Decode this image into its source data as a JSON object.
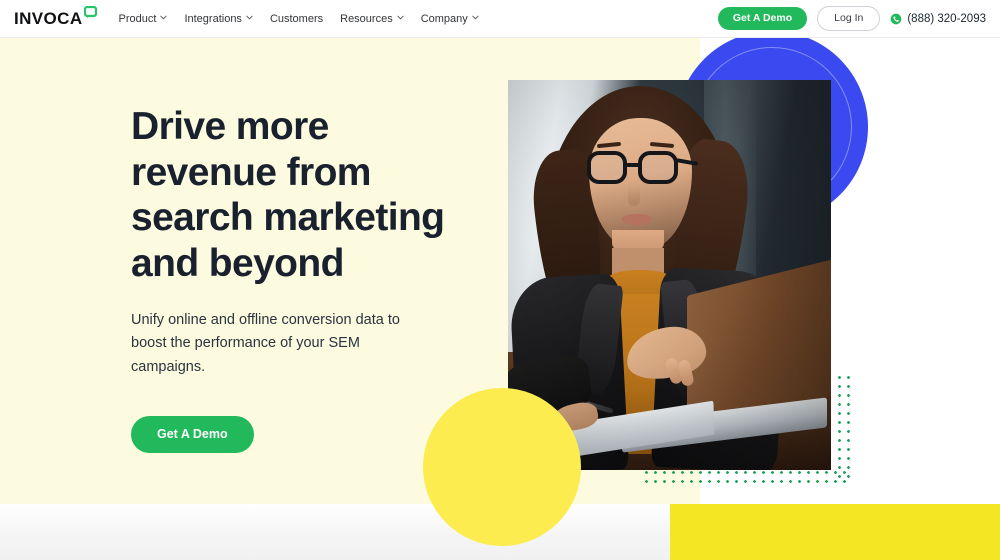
{
  "header": {
    "logo": {
      "wordmark": "INVOCA",
      "icon": "speech-bubble-icon"
    },
    "nav_items": [
      {
        "label": "Product",
        "has_dropdown": true
      },
      {
        "label": "Integrations",
        "has_dropdown": true
      },
      {
        "label": "Customers",
        "has_dropdown": false
      },
      {
        "label": "Resources",
        "has_dropdown": true
      },
      {
        "label": "Company",
        "has_dropdown": true
      }
    ],
    "cta_demo": "Get A Demo",
    "cta_login": "Log In",
    "phone": "(888) 320-2093",
    "phone_icon": "phone-icon"
  },
  "hero": {
    "headline": "Drive more revenue from search marketing and beyond",
    "subhead": "Unify online and offline conversion data to boost the performance of your SEM campaigns.",
    "cta": "Get A Demo",
    "image_alt": "Woman with glasses working on a laptop at a desk"
  },
  "colors": {
    "brand_green": "#21B95B",
    "accent_blue": "#3A49F0",
    "accent_yellow": "#FCEC4F",
    "band_yellow": "#F5E624",
    "hero_bg": "#FCFBE0",
    "dot_green": "#22A35B",
    "headline": "#19202E"
  }
}
